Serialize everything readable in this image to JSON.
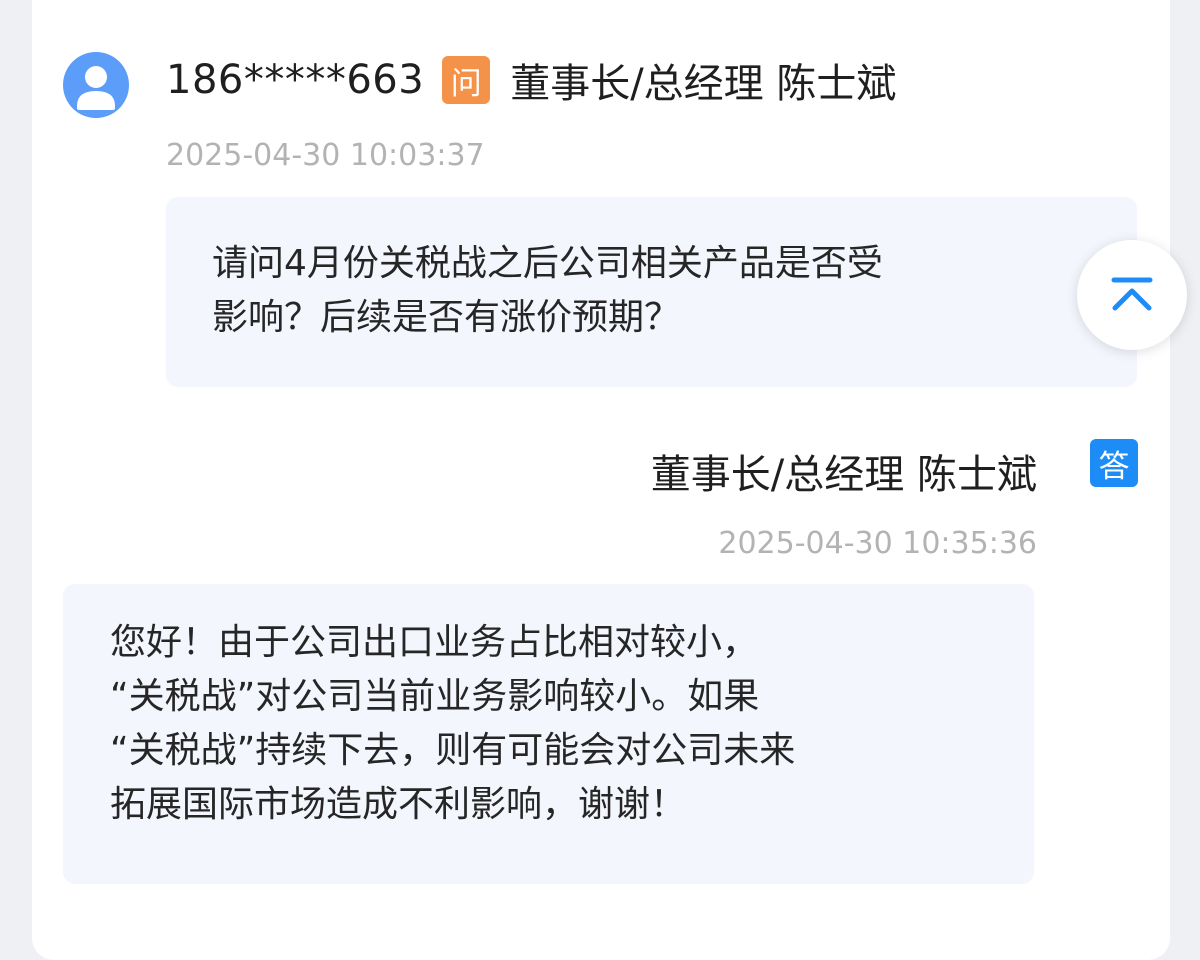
{
  "question": {
    "asker": "186*****663",
    "badge": "问",
    "target": "董事长/总经理 陈士斌",
    "time": "2025-04-30 10:03:37",
    "text_lines": [
      "请问4月份关税战之后公司相关产品是否受",
      "影响？后续是否有涨价预期？"
    ]
  },
  "answer": {
    "responder": "董事长/总经理 陈士斌",
    "badge": "答",
    "time": "2025-04-30 10:35:36",
    "text_lines": [
      "您好！由于公司出口业务占比相对较小，",
      "“关税战”对公司当前业务影响较小。如果",
      "“关税战”持续下去，则有可能会对公司未来",
      "拓展国际市场造成不利影响，谢谢！"
    ]
  },
  "icons": {
    "avatar": "user-avatar-icon",
    "scroll_top": "back-to-top-icon"
  },
  "colors": {
    "question_badge": "#f5924a",
    "answer_badge": "#1e8cf7",
    "avatar": "#5b9df9",
    "accent": "#1e8cf7"
  }
}
